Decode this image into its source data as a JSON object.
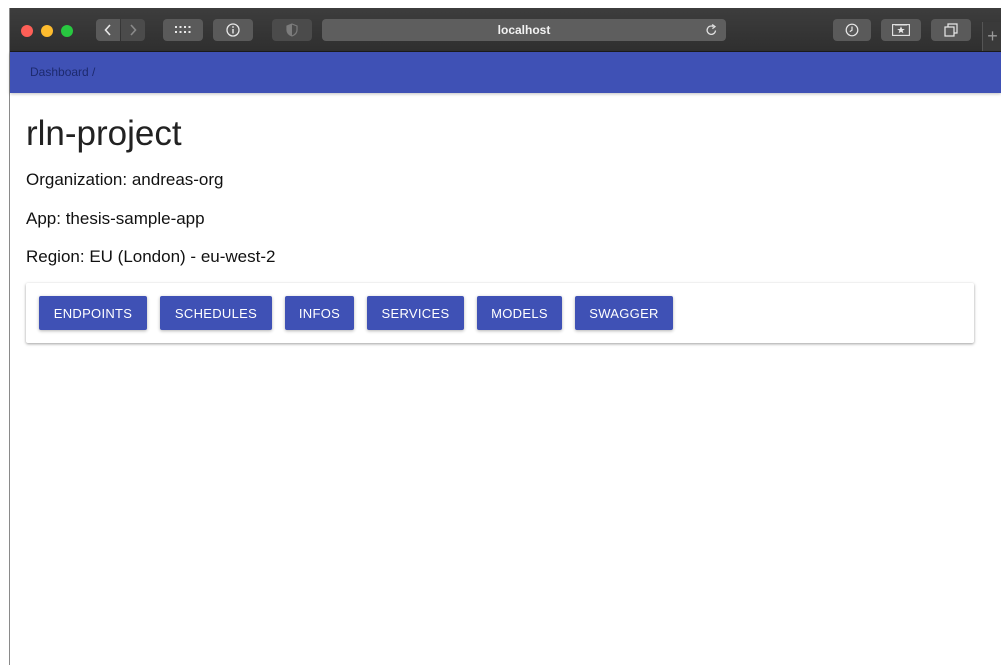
{
  "browser": {
    "address": "localhost",
    "icons": {
      "back": "chevron-left-icon",
      "forward": "chevron-right-icon",
      "grid": "grid-icon",
      "info": "info-icon",
      "shield": "shield-icon",
      "reload": "reload-icon",
      "history": "clock-icon",
      "bookmark": "star-icon",
      "tabs": "tabs-icon",
      "new_tab": "plus-icon"
    }
  },
  "header": {
    "breadcrumb": "Dashboard  /",
    "color": "#3f51b5"
  },
  "project": {
    "title": "rln-project",
    "organization": "Organization: andreas-org",
    "app": "App: thesis-sample-app",
    "region": "Region: EU (London) - eu-west-2"
  },
  "actions": {
    "endpoints": "ENDPOINTS",
    "schedules": "SCHEDULES",
    "infos": "INFOS",
    "services": "SERVICES",
    "models": "MODELS",
    "swagger": "SWAGGER"
  },
  "colors": {
    "primary": "#3f51b5",
    "close": "#fe5f57",
    "minimize": "#febc2e",
    "zoom": "#28c840"
  }
}
